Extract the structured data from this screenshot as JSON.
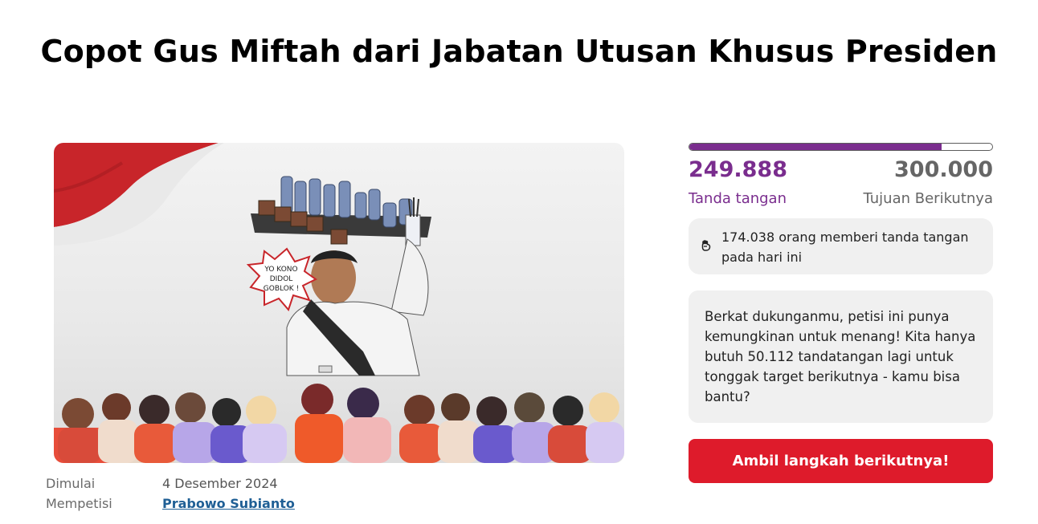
{
  "petition": {
    "title": "Copot Gus Miftah dari Jabatan Utusan Khusus Presiden"
  },
  "hero_image": {
    "speech_bubble": [
      "YO KONO",
      "DIDOL",
      "GOBLOK !"
    ]
  },
  "meta": {
    "started_label": "Dimulai",
    "started_value": "4 Desember 2024",
    "petitioning_label": "Mempetisi",
    "petitioning_value": "Prabowo Subianto"
  },
  "progress": {
    "fraction": 0.833,
    "current": "249.888",
    "current_label": "Tanda tangan",
    "goal": "300.000",
    "goal_label": "Tujuan Berikutnya"
  },
  "today": {
    "icon": "fist-icon",
    "text": "174.038 orang memberi tanda tangan pada hari ini"
  },
  "info": {
    "text": "Berkat dukunganmu, petisi ini punya kemungkinan untuk menang! Kita hanya butuh 50.112 tandatangan lagi untuk tonggak target berikutnya - kamu bisa bantu?"
  },
  "cta": {
    "label": "Ambil langkah berikutnya!"
  },
  "colors": {
    "brand_purple": "#7a2d8e",
    "cta_red": "#de1b2b",
    "link_blue": "#1f5f95"
  }
}
